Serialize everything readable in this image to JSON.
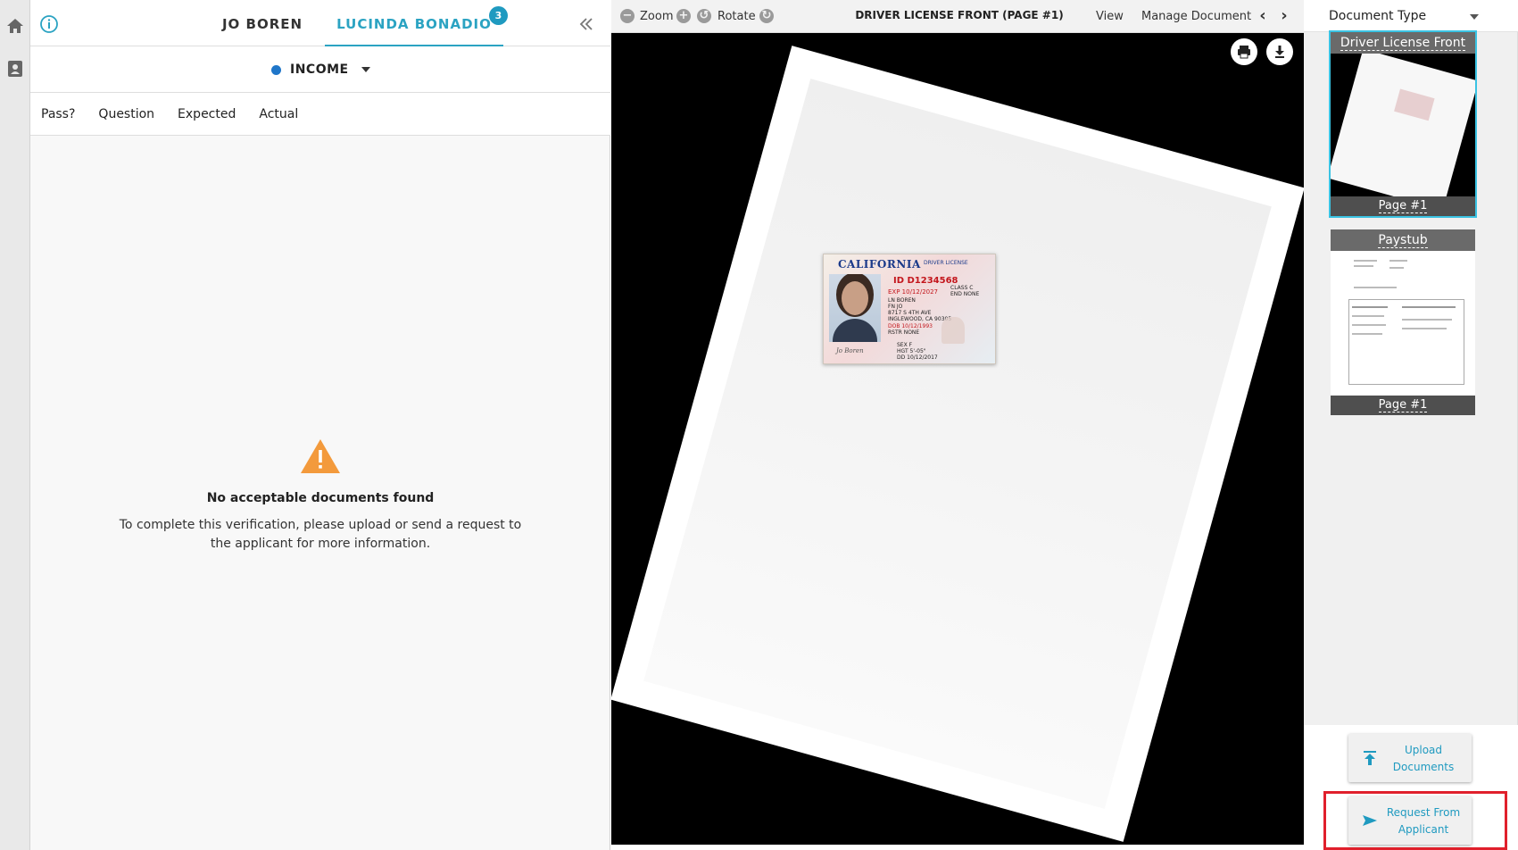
{
  "sidebar": {
    "icons": [
      "home-icon",
      "contact-card-icon"
    ]
  },
  "left_panel": {
    "tabs": [
      {
        "label": "JO BOREN"
      },
      {
        "label": "LUCINDA BONADIO",
        "badge": "3"
      }
    ],
    "category": {
      "label": "INCOME",
      "dot_color": "#1f76c9"
    },
    "columns": [
      "Pass?",
      "Question",
      "Expected",
      "Actual"
    ],
    "empty_state": {
      "title": "No acceptable documents found",
      "message": "To complete this verification, please upload or send a request to the applicant for more information."
    }
  },
  "viewer": {
    "toolbar": {
      "zoom_label": "Zoom",
      "rotate_label": "Rotate",
      "document_title": "DRIVER LICENSE FRONT (PAGE #1)",
      "view_label": "View",
      "manage_label": "Manage Document"
    },
    "license": {
      "state": "CALIFORNIA",
      "type": "DRIVER LICENSE",
      "id": "ID D1234568",
      "exp": "EXP 10/12/2027",
      "ln": "LN BOREN",
      "fn": "FN JO",
      "address1": "8717 S 4TH AVE",
      "address2": "INGLEWOOD, CA 90305",
      "dob": "DOB 10/12/1993",
      "rstr": "RSTR NONE",
      "class": "CLASS C",
      "end": "END NONE",
      "sex": "SEX F",
      "hgt": "HGT 5'-05\"",
      "dd": "DD 10/12/2017"
    }
  },
  "right_panel": {
    "document_type_label": "Document Type",
    "thumbnails": [
      {
        "title": "Driver License Front",
        "page": "Page #1",
        "selected": true
      },
      {
        "title": "Paystub",
        "page": "Page #1",
        "selected": false
      }
    ],
    "actions": {
      "upload_label": "Upload Documents",
      "request_label": "Request From Applicant"
    }
  },
  "colors": {
    "accent": "#2ba3c2",
    "highlight": "#e0202c",
    "warning": "#f39a3c"
  }
}
